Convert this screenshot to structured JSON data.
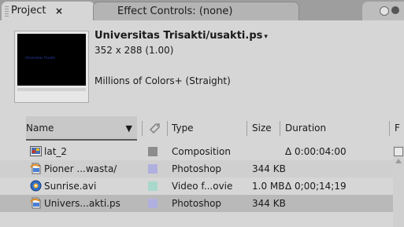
{
  "tabs": {
    "project_label": "Project",
    "project_close": "×",
    "effects_label": "Effect Controls: (none)"
  },
  "preview": {
    "thumb_text": "Universitas Trisakti",
    "title": "Universitas Trisakti/usakti.ps",
    "title_arrow": "▾",
    "dimensions": "352 x 288 (1.00)",
    "color_info": "Millions of Colors+ (Straight)"
  },
  "columns": {
    "name": "Name",
    "name_sort": "❯",
    "label_icon": "tag-icon",
    "type": "Type",
    "size": "Size",
    "duration": "Duration",
    "f": "F"
  },
  "items": [
    {
      "name": "lat_2",
      "icon": "composition-icon",
      "label_color": "#8c8c8c",
      "type": "Composition",
      "size": "",
      "duration": "Δ 0:00:04:00"
    },
    {
      "name": "Pioner ...wasta/",
      "icon": "photoshop-file-icon",
      "label_color": "#b0b0e0",
      "type": "Photoshop",
      "size": "344 KB",
      "duration": ""
    },
    {
      "name": "Sunrise.avi",
      "icon": "video-file-icon",
      "label_color": "#a8d8cc",
      "type": "Video f...ovie",
      "size": "1.0 MB",
      "duration": "Δ 0;00;14;19"
    },
    {
      "name": "Univers...akti.ps",
      "icon": "photoshop-file-icon",
      "label_color": "#b0b0e0",
      "type": "Photoshop",
      "size": "344 KB",
      "duration": ""
    }
  ]
}
